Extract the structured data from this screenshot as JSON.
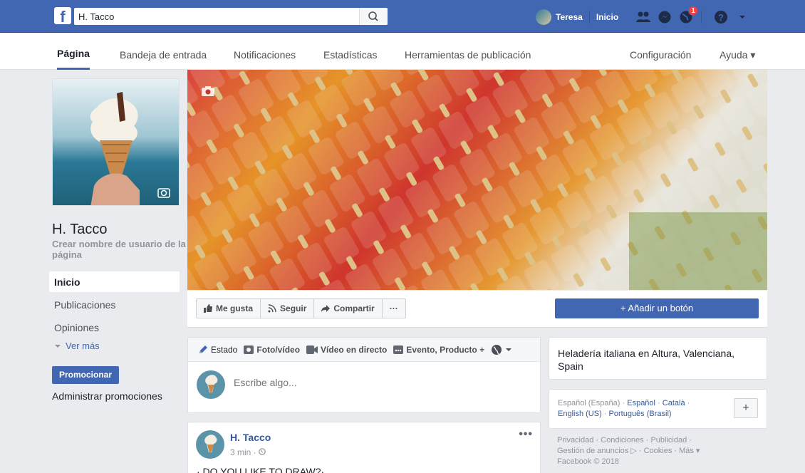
{
  "topbar": {
    "search_value": "H. Tacco",
    "user_name": "Teresa",
    "home_label": "Inicio",
    "notifications_count": "1"
  },
  "pagenav": {
    "tabs": [
      {
        "label": "Página",
        "active": true
      },
      {
        "label": "Bandeja de entrada"
      },
      {
        "label": "Notificaciones"
      },
      {
        "label": "Estadísticas"
      },
      {
        "label": "Herramientas de publicación"
      },
      {
        "label": "Configuración"
      },
      {
        "label": "Ayuda ▾"
      }
    ]
  },
  "left": {
    "page_name": "H. Tacco",
    "username_link": "Crear nombre de usuario de la página",
    "nav": [
      {
        "label": "Inicio",
        "active": true
      },
      {
        "label": "Publicaciones"
      },
      {
        "label": "Opiniones"
      }
    ],
    "more_label": "Ver más",
    "promote_label": "Promocionar",
    "manage_promotions_label": "Administrar promociones"
  },
  "actions": {
    "like_label": "Me gusta",
    "follow_label": "Seguir",
    "share_label": "Compartir",
    "more_label": "···",
    "add_button_label": "+ Añadir un botón"
  },
  "composer": {
    "tabs": [
      "Estado",
      "Foto/vídeo",
      "Vídeo en directo",
      "Evento, Producto +"
    ],
    "placeholder": "Escribe algo..."
  },
  "post": {
    "author": "H. Tacco",
    "meta": "3 min · ",
    "more": "•••",
    "text": "· DO YOU LIKE TO DRAW?·"
  },
  "right": {
    "about": "Heladería italiana en Altura, Valenciana, Spain",
    "languages": {
      "current": "Español (España)",
      "links": [
        "Español",
        "Català",
        "English (US)",
        "Português (Brasil)"
      ]
    },
    "plus_label": "+",
    "footer_line1": "Privacidad · Condiciones · Publicidad ·",
    "footer_line2": "Gestión de anuncios ▷ · Cookies · Más ▾",
    "footer_line3": "Facebook © 2018"
  },
  "colors": {
    "brand": "#4267b2",
    "background": "#e9ebee",
    "link": "#365899"
  }
}
